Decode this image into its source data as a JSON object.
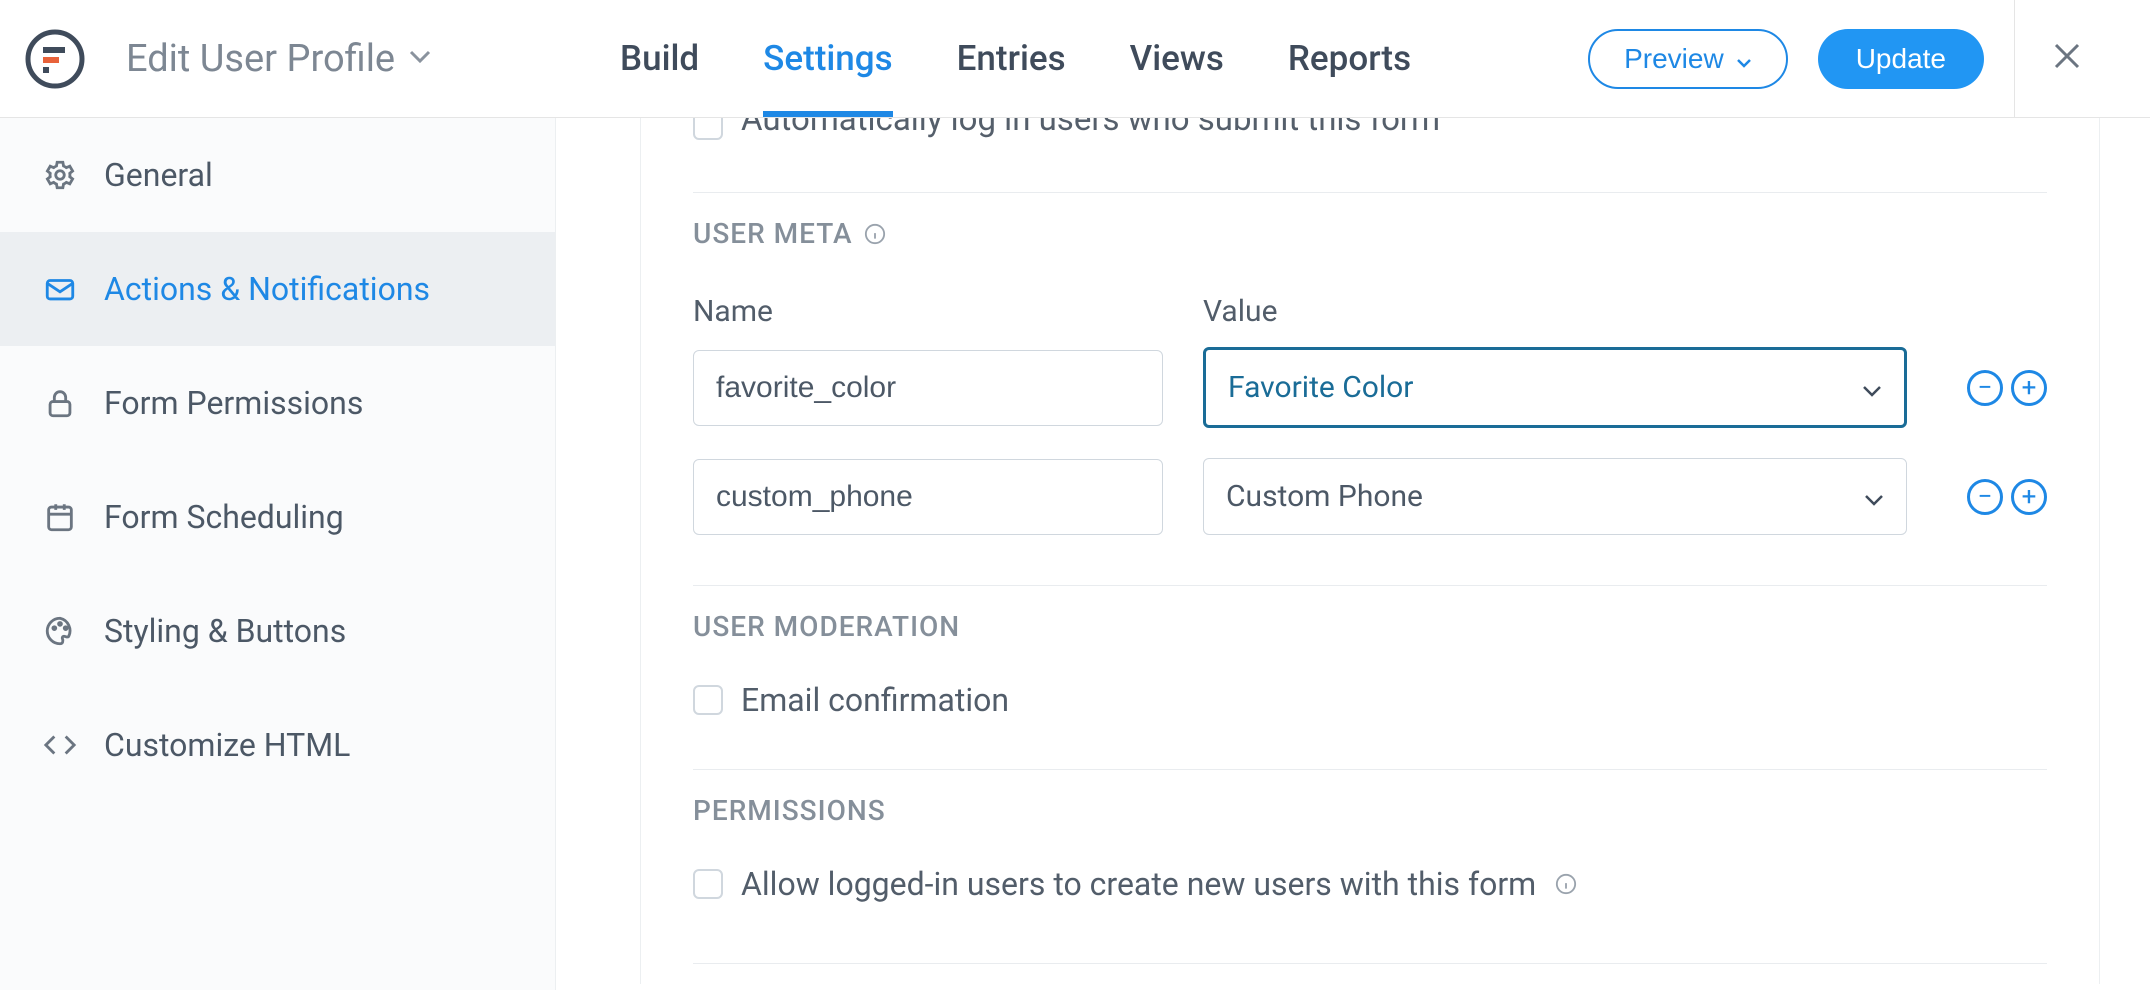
{
  "header": {
    "page_title": "Edit User Profile",
    "tabs": {
      "build": "Build",
      "settings": "Settings",
      "entries": "Entries",
      "views": "Views",
      "reports": "Reports"
    },
    "preview_label": "Preview",
    "update_label": "Update"
  },
  "sidebar": {
    "general": "General",
    "actions": "Actions & Notifications",
    "permissions": "Form Permissions",
    "scheduling": "Form Scheduling",
    "styling": "Styling & Buttons",
    "customize": "Customize HTML"
  },
  "content": {
    "auto_login_label": "Automatically log in users who submit this form",
    "user_meta_title": "USER META",
    "meta_head_name": "Name",
    "meta_head_value": "Value",
    "meta_rows": [
      {
        "name": "favorite_color",
        "value": "Favorite Color"
      },
      {
        "name": "custom_phone",
        "value": "Custom Phone"
      }
    ],
    "user_moderation_title": "USER MODERATION",
    "email_confirmation_label": "Email confirmation",
    "permissions_title": "PERMISSIONS",
    "allow_logged_in_label": "Allow logged-in users to create new users with this form"
  }
}
